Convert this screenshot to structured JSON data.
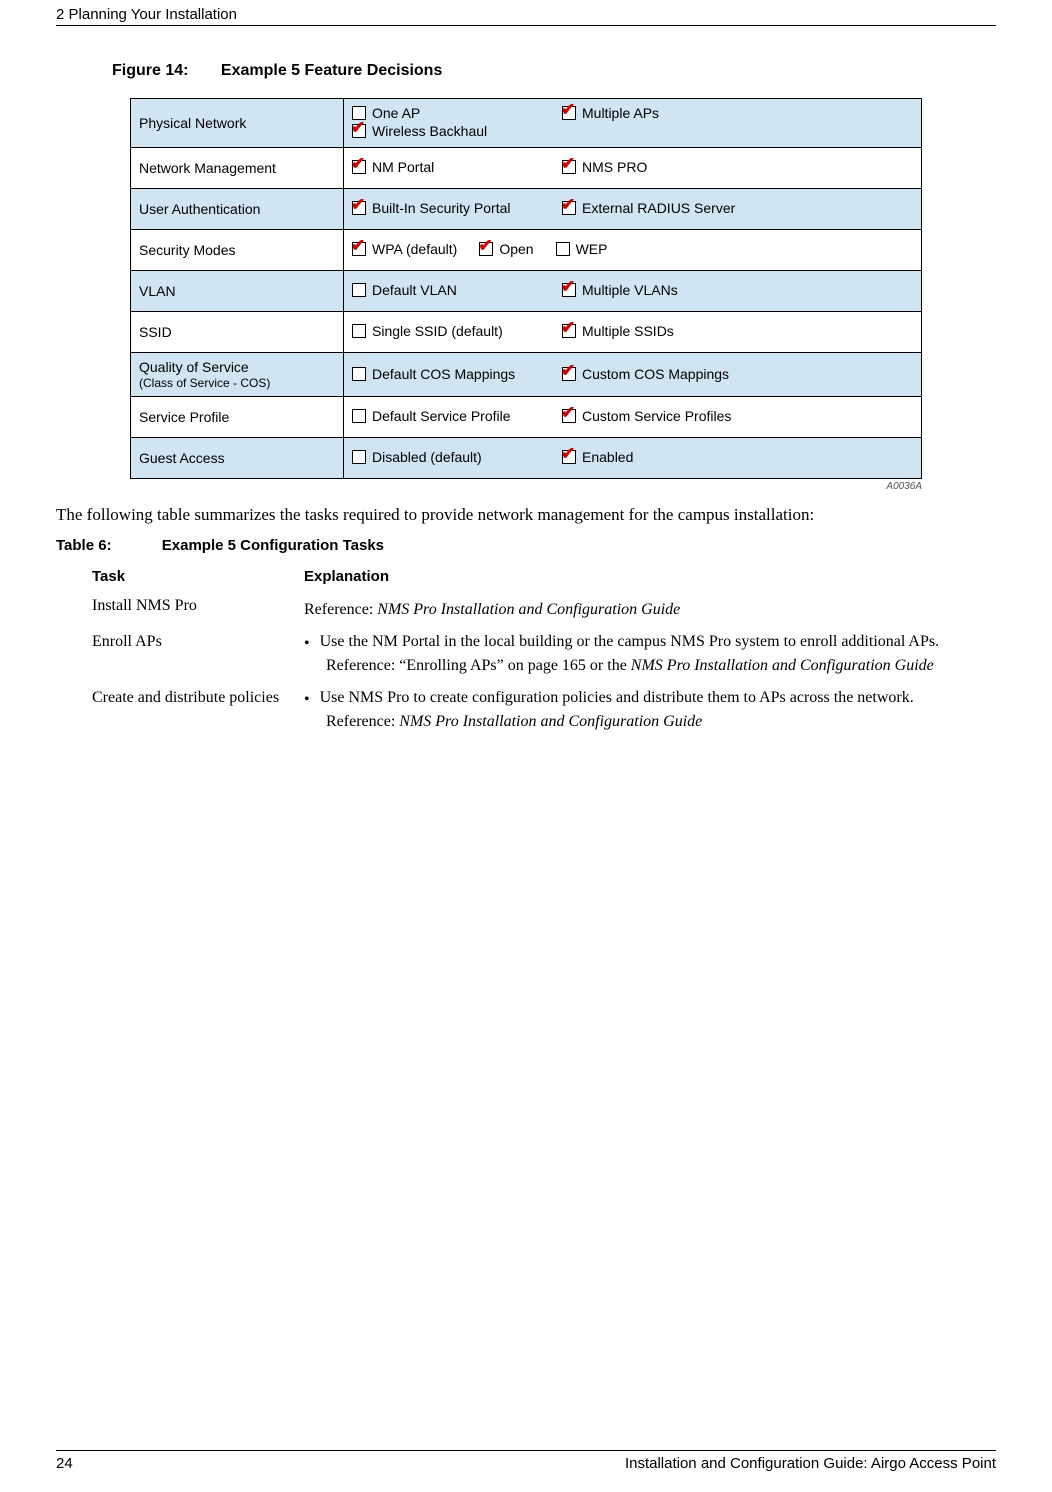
{
  "header": {
    "chapter_label": "2  Planning Your Installation"
  },
  "figure": {
    "number_label": "Figure 14:",
    "title": "Example 5 Feature Decisions",
    "ref_id": "A0036A",
    "rows": [
      {
        "shade": true,
        "label": "Physical Network",
        "options": [
          {
            "text": "One AP",
            "checked": false
          },
          {
            "text": "Multiple APs",
            "checked": true
          },
          {
            "text": "Wireless Backhaul",
            "checked": true
          }
        ]
      },
      {
        "shade": false,
        "label": "Network Management",
        "options": [
          {
            "text": "NM Portal",
            "checked": true
          },
          {
            "text": "NMS PRO",
            "checked": true
          }
        ]
      },
      {
        "shade": true,
        "label": "User Authentication",
        "options": [
          {
            "text": "Built-In Security Portal",
            "checked": true
          },
          {
            "text": "External RADIUS Server",
            "checked": true
          }
        ]
      },
      {
        "shade": false,
        "label": "Security Modes",
        "options": [
          {
            "text": "WPA (default)",
            "checked": true
          },
          {
            "text": "Open",
            "checked": true
          },
          {
            "text": "WEP",
            "checked": false
          }
        ]
      },
      {
        "shade": true,
        "label": "VLAN",
        "options": [
          {
            "text": "Default VLAN",
            "checked": false
          },
          {
            "text": "Multiple VLANs",
            "checked": true
          }
        ]
      },
      {
        "shade": false,
        "label": "SSID",
        "options": [
          {
            "text": "Single SSID (default)",
            "checked": false
          },
          {
            "text": "Multiple SSIDs",
            "checked": true
          }
        ]
      },
      {
        "shade": true,
        "label": "Quality of Service",
        "sublabel": "(Class of Service - COS)",
        "options": [
          {
            "text": "Default COS Mappings",
            "checked": false
          },
          {
            "text": "Custom COS Mappings",
            "checked": true
          }
        ]
      },
      {
        "shade": false,
        "label": "Service Profile",
        "options": [
          {
            "text": "Default Service Profile",
            "checked": false
          },
          {
            "text": "Custom Service Profiles",
            "checked": true
          }
        ]
      },
      {
        "shade": true,
        "label": "Guest Access",
        "options": [
          {
            "text": "Disabled (default)",
            "checked": false
          },
          {
            "text": "Enabled",
            "checked": true
          }
        ]
      }
    ]
  },
  "body": {
    "para1": "The following table summarizes the tasks required to provide network management for the campus installation:"
  },
  "table": {
    "number_label": "Table 6:",
    "title": "Example 5 Configuration Tasks",
    "head_task": "Task",
    "head_explanation": "Explanation",
    "rows": [
      {
        "task": "Install NMS Pro",
        "lines": [
          {
            "type": "ref",
            "prefix": "Reference: ",
            "ital": "NMS Pro Installation and Configuration Guide"
          }
        ]
      },
      {
        "task": "Enroll APs",
        "lines": [
          {
            "type": "bullet",
            "text": "Use the NM Portal in the local building or the campus NMS Pro system to enroll additional APs."
          },
          {
            "type": "ref",
            "prefix": "Reference: “Enrolling APs” on page 165 or the ",
            "ital": "NMS Pro Installation and Configuration Guide"
          }
        ]
      },
      {
        "task": "Create and distribute policies",
        "lines": [
          {
            "type": "bullet",
            "text": "Use NMS Pro to create configuration policies and distribute them to APs across the network."
          },
          {
            "type": "ref",
            "prefix": "Reference: ",
            "ital": "NMS Pro Installation and Configuration Guide"
          }
        ]
      }
    ]
  },
  "footer": {
    "page_number": "24",
    "doc_title": "Installation and Configuration Guide: Airgo Access Point"
  }
}
